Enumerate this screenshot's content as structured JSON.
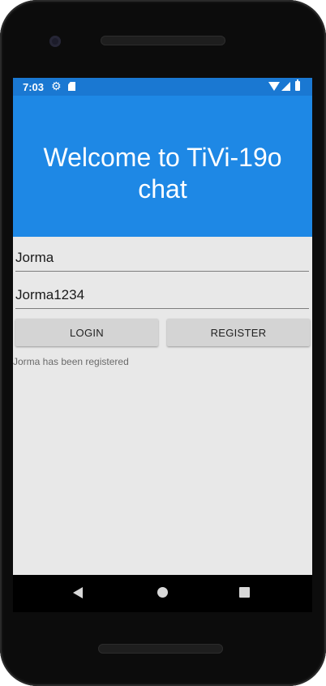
{
  "status_bar": {
    "time": "7:03",
    "icons": [
      "gear-icon",
      "sd-card-icon",
      "wifi-icon",
      "signal-icon",
      "battery-icon"
    ]
  },
  "header": {
    "title": "Welcome to TiVi-19o chat",
    "background_color": "#1e88e5"
  },
  "form": {
    "username_value": "Jorma",
    "password_value": "Jorma1234",
    "login_label": "LOGIN",
    "register_label": "REGISTER"
  },
  "status_message": "Jorma has been registered",
  "nav_bar": {
    "icons": [
      "back-icon",
      "home-icon",
      "recents-icon"
    ]
  },
  "colors": {
    "accent": "#1e88e5",
    "status_bar": "#1a78d2",
    "screen_background": "#e8e8e8",
    "button_background": "#d4d4d4"
  }
}
